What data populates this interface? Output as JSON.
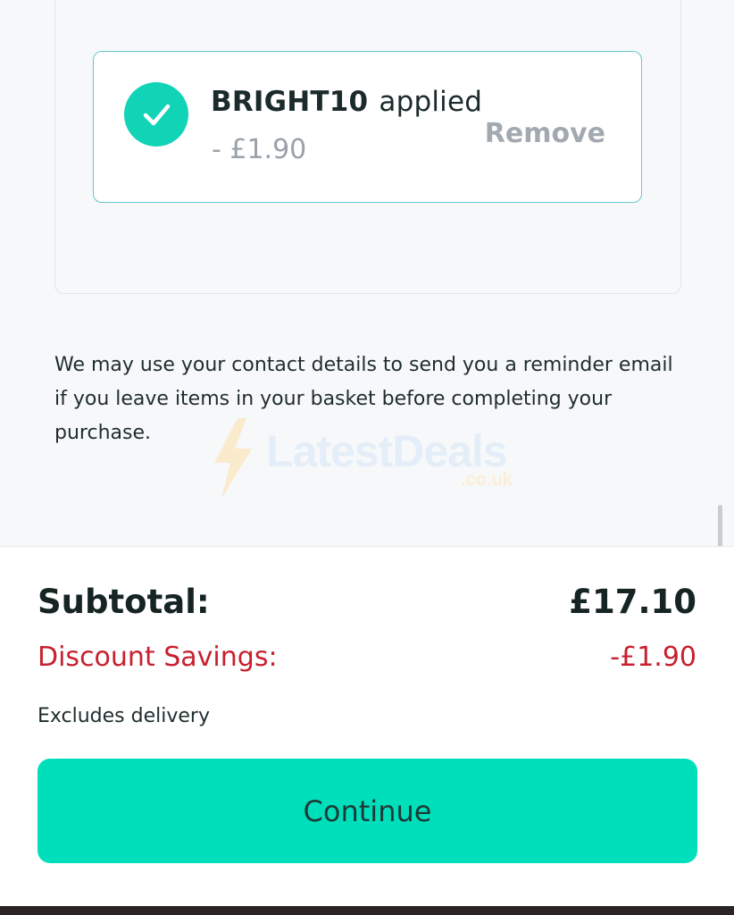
{
  "coupon": {
    "code": "BRIGHT10",
    "status": "applied",
    "amount": "- £1.90",
    "remove_label": "Remove",
    "icon": "checkmark-icon"
  },
  "notice": {
    "text": "We may use your contact details to send you a reminder email if you leave items in your basket before completing your purchase."
  },
  "watermark": {
    "brand": "LatestDeals",
    "domain": ".co.uk",
    "icon": "lightning-bolt-icon"
  },
  "summary": {
    "subtotal_label": "Subtotal:",
    "subtotal_value": "£17.10",
    "discount_label": "Discount Savings:",
    "discount_value": "-£1.90",
    "excludes_text": "Excludes delivery",
    "continue_label": "Continue"
  },
  "colors": {
    "accent": "#00dfbb",
    "check_circle": "#11d3b6",
    "discount_red": "#c8202f",
    "coupon_border": "#67c6cc"
  }
}
